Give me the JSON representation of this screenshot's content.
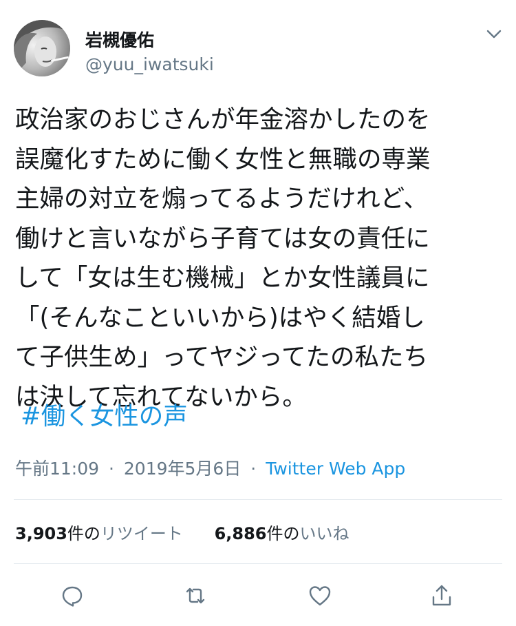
{
  "author": {
    "display_name": "岩槻優佑",
    "handle": "@yuu_iwatsuki"
  },
  "tweet": {
    "lines": [
      "政治家のおじさんが年金溶かしたのを",
      "誤魔化すために働く女性と無職の専業",
      "主婦の対立を煽ってるようだけれど、",
      "働けと言いながら子育ては女の責任に",
      "して「女は生む機械」とか女性議員に",
      "「(そんなこといいから)はやく結婚し",
      "て子供生め」ってヤジってたの私たち",
      "は決して忘れてないから。"
    ],
    "hashtag": "#働く女性の声"
  },
  "meta": {
    "time": "午前11:09",
    "separator": "·",
    "date": "2019年5月6日",
    "source": "Twitter Web App"
  },
  "stats": {
    "retweets": {
      "count": "3,903",
      "unit": "件の",
      "label": "リツイート"
    },
    "likes": {
      "count": "6,886",
      "unit": "件の",
      "label": "いいね"
    }
  },
  "icons": {
    "caret": "chevron-down-icon",
    "reply": "reply-icon",
    "retweet": "retweet-icon",
    "like": "heart-icon",
    "share": "share-icon"
  },
  "colors": {
    "text": "#14171a",
    "secondary": "#657786",
    "link": "#1b95e0",
    "divider": "#e1e8ed"
  }
}
